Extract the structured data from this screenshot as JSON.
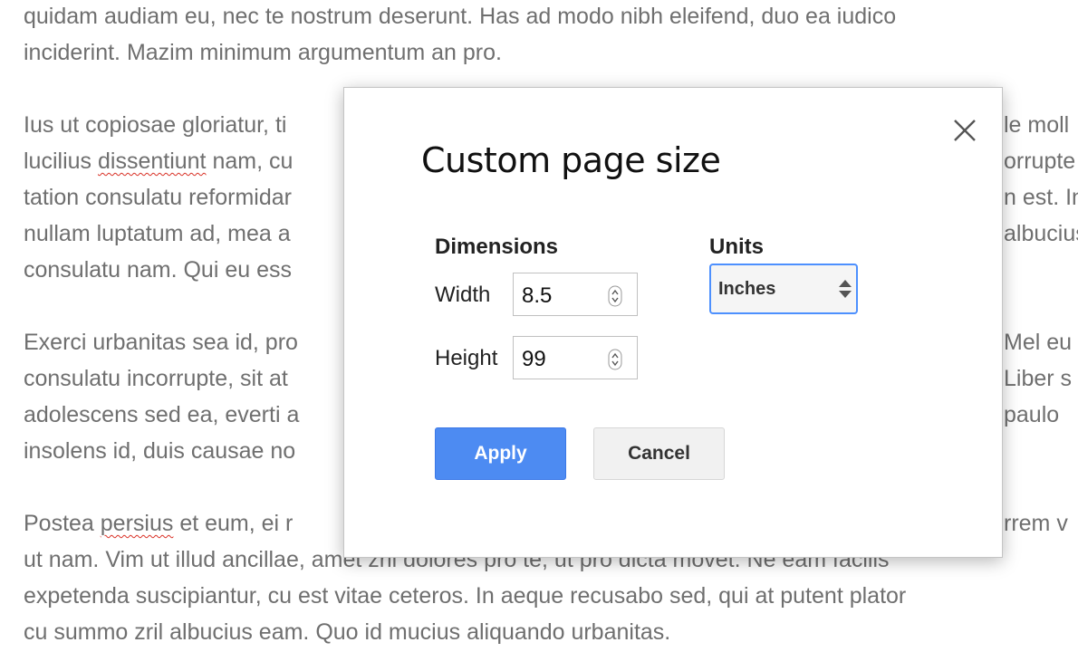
{
  "document": {
    "lines": [
      {
        "segments": [
          {
            "text": "quidam audiam eu, nec te nostrum deserunt. Has ad modo nibh eleifend, duo ea iudico"
          }
        ]
      },
      {
        "segments": [
          {
            "text": "inciderint. Mazim minimum argumentum an pro."
          }
        ]
      },
      {
        "segments": [
          {
            "text": ""
          }
        ]
      },
      {
        "segments": [
          {
            "text": "Ius ut copiosae gloriatur, ti"
          },
          {
            "text": "                                                                                                  "
          },
          {
            "text": "le moll"
          }
        ]
      },
      {
        "segments": [
          {
            "text": "lucilius "
          },
          {
            "text": "dissentiunt",
            "misspelled": true
          },
          {
            "text": " nam, cu"
          }
        ]
      },
      {
        "segments": [
          {
            "text": "tation consulatu reformidar"
          }
        ]
      },
      {
        "segments": [
          {
            "text": "nullam luptatum ad, mea a"
          }
        ]
      },
      {
        "segments": [
          {
            "text": "consulatu nam. Qui eu ess"
          }
        ]
      },
      {
        "segments": [
          {
            "text": ""
          }
        ]
      },
      {
        "segments": [
          {
            "text": "Exerci urbanitas sea id, pro"
          }
        ]
      },
      {
        "segments": [
          {
            "text": "consulatu incorrupte, sit at"
          }
        ]
      },
      {
        "segments": [
          {
            "text": "adolescens sed ea, everti a"
          }
        ]
      },
      {
        "segments": [
          {
            "text": "insolens id, duis causae no"
          }
        ]
      },
      {
        "segments": [
          {
            "text": ""
          }
        ]
      },
      {
        "segments": [
          {
            "text": "Postea "
          },
          {
            "text": "persius",
            "misspelled": true
          },
          {
            "text": " et eum, ei r"
          }
        ]
      },
      {
        "segments": [
          {
            "text": "ut nam. Vim ut illud ancillae, amet zril dolores pro te, ut pro dicta movet. Ne eam facilis"
          }
        ]
      },
      {
        "segments": [
          {
            "text": "expetenda suscipiantur, cu est vitae ceteros. In aeque recusabo sed, qui at putent plator"
          }
        ]
      },
      {
        "segments": [
          {
            "text": "cu summo zril albucius eam. Quo id mucius aliquando urbanitas."
          }
        ]
      }
    ],
    "right_fragments": [
      {
        "line": 3,
        "text": "le moll"
      },
      {
        "line": 4,
        "text": "orrupte"
      },
      {
        "line": 5,
        "text": "n est. In"
      },
      {
        "line": 6,
        "text": "albucius"
      },
      {
        "line": 9,
        "text": "Mel eu"
      },
      {
        "line": 10,
        "text": "Liber s"
      },
      {
        "line": 11,
        "text": "paulo"
      },
      {
        "line": 14,
        "text": "rrem v"
      }
    ]
  },
  "dialog": {
    "title": "Custom page size",
    "dimensions_label": "Dimensions",
    "units_label": "Units",
    "width_label": "Width",
    "width_value": "8.5",
    "height_label": "Height",
    "height_value": "99",
    "units_value": "Inches",
    "apply_label": "Apply",
    "cancel_label": "Cancel",
    "close_icon": "close-icon"
  },
  "colors": {
    "primary_button": "#4d8bf2",
    "focus_border": "#4d90fe",
    "body_text": "#6f6f6f"
  }
}
